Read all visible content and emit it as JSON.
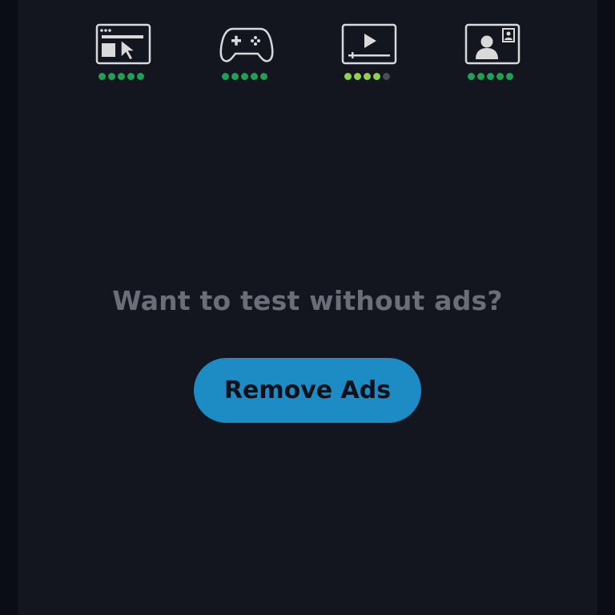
{
  "colors": {
    "background": "#0b0d16",
    "panel": "#13151f",
    "icon_stroke": "#d9d9d9",
    "dot_on": "#1fa055",
    "dot_on_light": "#8fd14f",
    "dot_off": "#4a4c55",
    "promo_text": "#6b6e79",
    "button_bg": "#1d8cc4",
    "button_text": "#0e1118"
  },
  "ratings": [
    {
      "icon": "browser-cursor-icon",
      "score": 5,
      "max": 5
    },
    {
      "icon": "gamepad-icon",
      "score": 5,
      "max": 5
    },
    {
      "icon": "video-player-icon",
      "score": 4,
      "max": 5
    },
    {
      "icon": "video-call-icon",
      "score": 5,
      "max": 5
    }
  ],
  "promo": {
    "text": "Want to test without ads?",
    "button_label": "Remove Ads"
  }
}
